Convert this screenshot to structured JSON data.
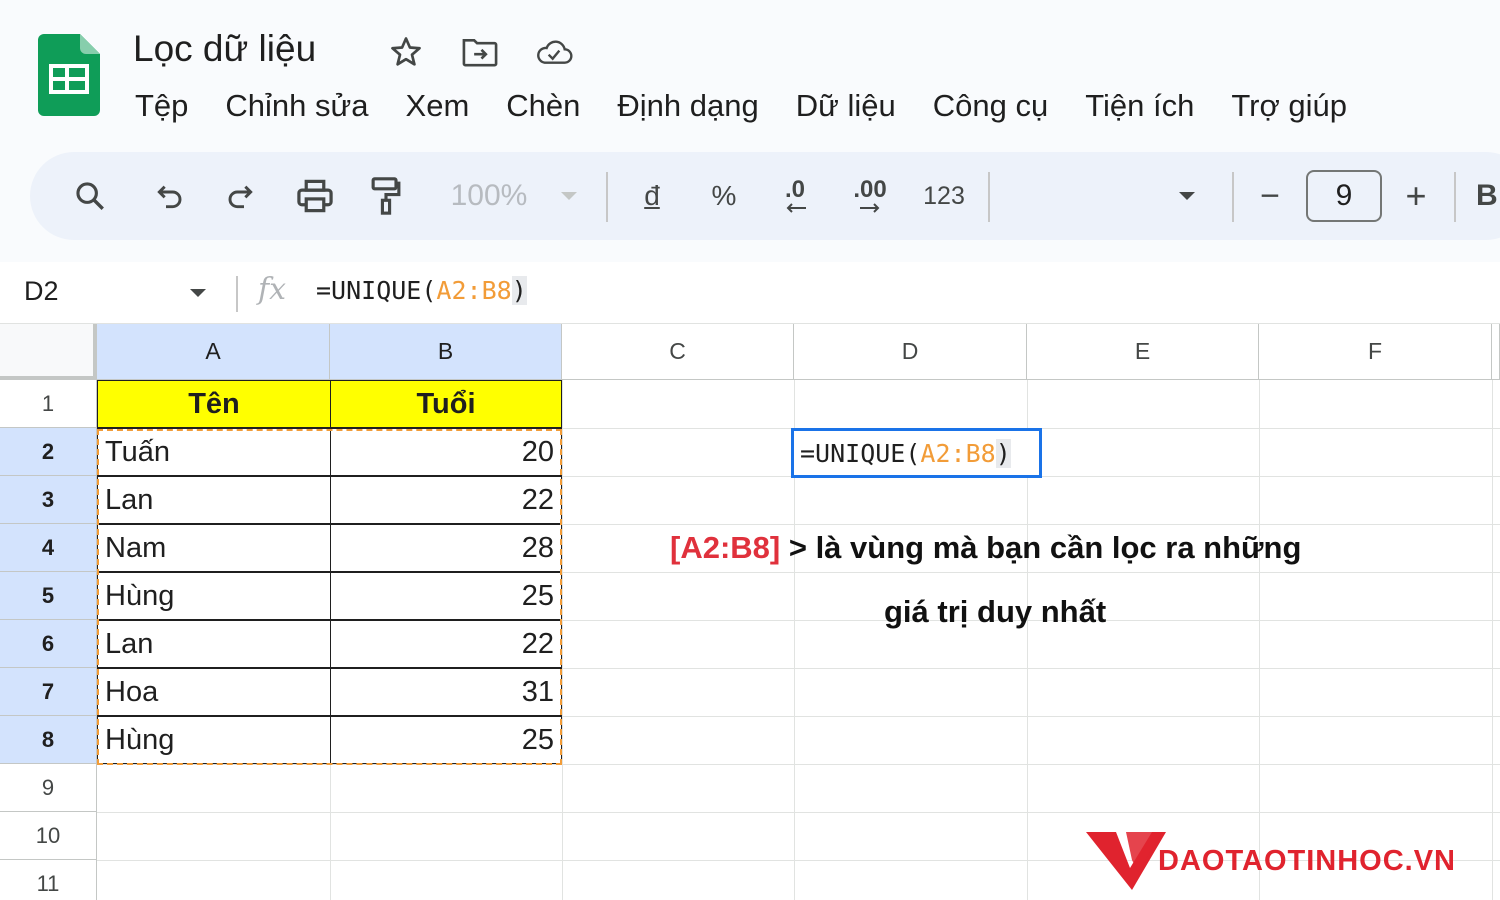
{
  "app": {
    "title": "Lọc dữ liệu",
    "icons": [
      "star-icon",
      "move-to-folder-icon",
      "cloud-saved-icon"
    ],
    "brand_color": "#0f9d58"
  },
  "menu": [
    "Tệp",
    "Chỉnh sửa",
    "Xem",
    "Chèn",
    "Định dạng",
    "Dữ liệu",
    "Công cụ",
    "Tiện ích",
    "Trợ giúp"
  ],
  "toolbar": {
    "zoom": "100%",
    "currency": "đ",
    "percent": "%",
    "decrease_decimal": ".0",
    "increase_decimal": ".00",
    "number_format": "123",
    "font_size": "9",
    "minus": "−",
    "plus": "+",
    "bold_partial": "B"
  },
  "formula_bar": {
    "cell_ref": "D2",
    "fx": "fx",
    "formula_prefix": "=UNIQUE(",
    "formula_range": "A2:B8",
    "formula_suffix": ")"
  },
  "sheet": {
    "columns": [
      "A",
      "B",
      "C",
      "D",
      "E",
      "F"
    ],
    "rows": [
      "1",
      "2",
      "3",
      "4",
      "5",
      "6",
      "7",
      "8",
      "9",
      "10",
      "11"
    ],
    "header": {
      "name": "Tên",
      "age": "Tuổi"
    },
    "data": [
      {
        "name": "Tuấn",
        "age": "20"
      },
      {
        "name": "Lan",
        "age": "22"
      },
      {
        "name": "Nam",
        "age": "28"
      },
      {
        "name": "Hùng",
        "age": "25"
      },
      {
        "name": "Lan",
        "age": "22"
      },
      {
        "name": "Hoa",
        "age": "31"
      },
      {
        "name": "Hùng",
        "age": "25"
      }
    ],
    "selected_columns": [
      "A",
      "B"
    ],
    "selected_rows": [
      "2",
      "3",
      "4",
      "5",
      "6",
      "7",
      "8"
    ],
    "range_color": "#f29c38",
    "header_fill": "#ffff00",
    "active_color": "#1a73e8"
  },
  "annotation": {
    "range": "[A2:B8]",
    "text_1": " > là vùng mà bạn cần lọc ra những",
    "text_2": "giá trị duy nhất",
    "range_color": "#e0313c"
  },
  "watermark": {
    "text": "DAOTAOTINHOC.VN",
    "color": "#e0232e"
  }
}
